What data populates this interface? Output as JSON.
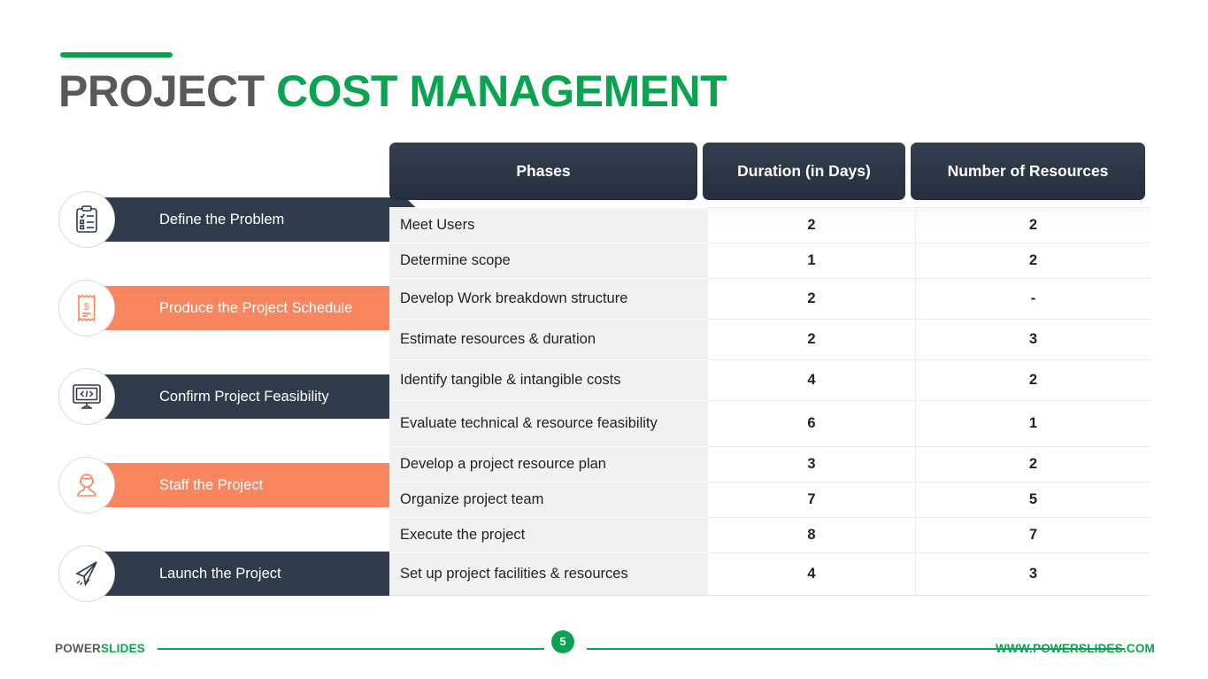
{
  "title": {
    "part1": "PROJECT",
    "part2": "COST MANAGEMENT"
  },
  "colors": {
    "green": "#0ba350",
    "navy": "#2f3b4b",
    "orange": "#f9855e",
    "title_dark": "#58595b",
    "row_bg": "#f1f1f1"
  },
  "steps": [
    {
      "label": "Define the Problem",
      "style": "navy",
      "icon": "clipboard-checklist-icon"
    },
    {
      "label": "Produce the Project Schedule",
      "style": "orange",
      "icon": "invoice-receipt-icon"
    },
    {
      "label": "Confirm Project Feasibility",
      "style": "navy",
      "icon": "monitor-code-icon"
    },
    {
      "label": "Staff the Project",
      "style": "orange",
      "icon": "person-user-icon"
    },
    {
      "label": "Launch the Project",
      "style": "navy",
      "icon": "paper-plane-icon"
    }
  ],
  "table": {
    "headers": [
      "Phases",
      "Duration (in Days)",
      "Number of Resources"
    ],
    "rows": [
      {
        "phase": "Meet Users",
        "duration": "2",
        "resources": "2"
      },
      {
        "phase": "Determine scope",
        "duration": "1",
        "resources": "2"
      },
      {
        "phase": "Develop Work breakdown structure",
        "duration": "2",
        "resources": "-"
      },
      {
        "phase": "Estimate resources & duration",
        "duration": "2",
        "resources": "3"
      },
      {
        "phase": "Identify tangible & intangible costs",
        "duration": "4",
        "resources": "2"
      },
      {
        "phase": "Evaluate technical & resource feasibility",
        "duration": "6",
        "resources": "1"
      },
      {
        "phase": "Develop a project resource plan",
        "duration": "3",
        "resources": "2"
      },
      {
        "phase": "Organize project team",
        "duration": "7",
        "resources": "5"
      },
      {
        "phase": "Execute the project",
        "duration": "8",
        "resources": "7"
      },
      {
        "phase": "Set up project facilities & resources",
        "duration": "4",
        "resources": "3"
      }
    ]
  },
  "footer": {
    "logo_part1": "POWER",
    "logo_part2": "SLIDES",
    "page_number": "5",
    "url": "WWW.POWERSLIDES.COM"
  }
}
